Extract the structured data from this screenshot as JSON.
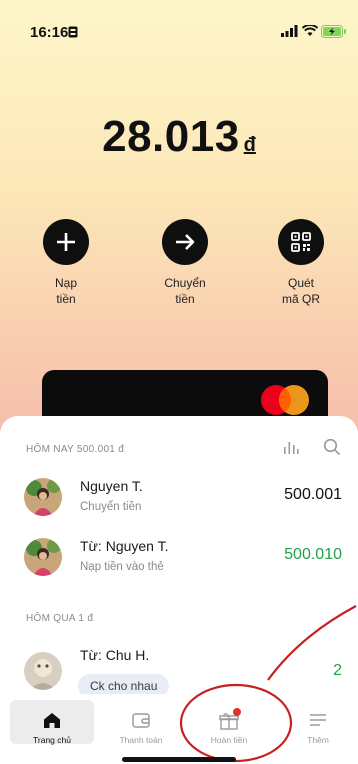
{
  "status_bar": {
    "time": "16:16"
  },
  "balance": {
    "amount": "28.013",
    "currency": "đ"
  },
  "actions": [
    {
      "label": "Nạp\ntiền",
      "icon": "plus-icon"
    },
    {
      "label": "Chuyển\ntiền",
      "icon": "arrow-right-icon"
    },
    {
      "label": "Quét\nmã QR",
      "icon": "qr-code-icon"
    }
  ],
  "transactions": {
    "today_header": "HÔM NAY 500.001 đ",
    "yesterday_header": "HÔM QUA 1 đ",
    "today": [
      {
        "title": "Nguyen T.",
        "subtitle": "Chuyển tiền",
        "amount": "500.001",
        "amount_color": "#111111"
      },
      {
        "title": "Từ: Nguyen T.",
        "subtitle": "Nạp tiền vào thẻ",
        "amount": "500.010",
        "amount_color": "#22a148"
      }
    ],
    "yesterday": [
      {
        "title": "Từ: Chu H.",
        "tooltip": "Ck cho nhau",
        "amount": "2",
        "amount_color": "#22a148"
      }
    ]
  },
  "nav": [
    {
      "label": "Trang chủ",
      "icon": "home-icon",
      "active": true
    },
    {
      "label": "Thanh toán",
      "icon": "wallet-icon"
    },
    {
      "label": "Hoàn tiền",
      "icon": "gift-icon",
      "badge": true
    },
    {
      "label": "Thêm",
      "icon": "menu-icon"
    }
  ],
  "colors": {
    "accent_green": "#22a148",
    "badge_red": "#e0322f",
    "annotation_red": "#c8201f",
    "mastercard_red": "#eb001b",
    "mastercard_orange": "#f79e1b"
  }
}
